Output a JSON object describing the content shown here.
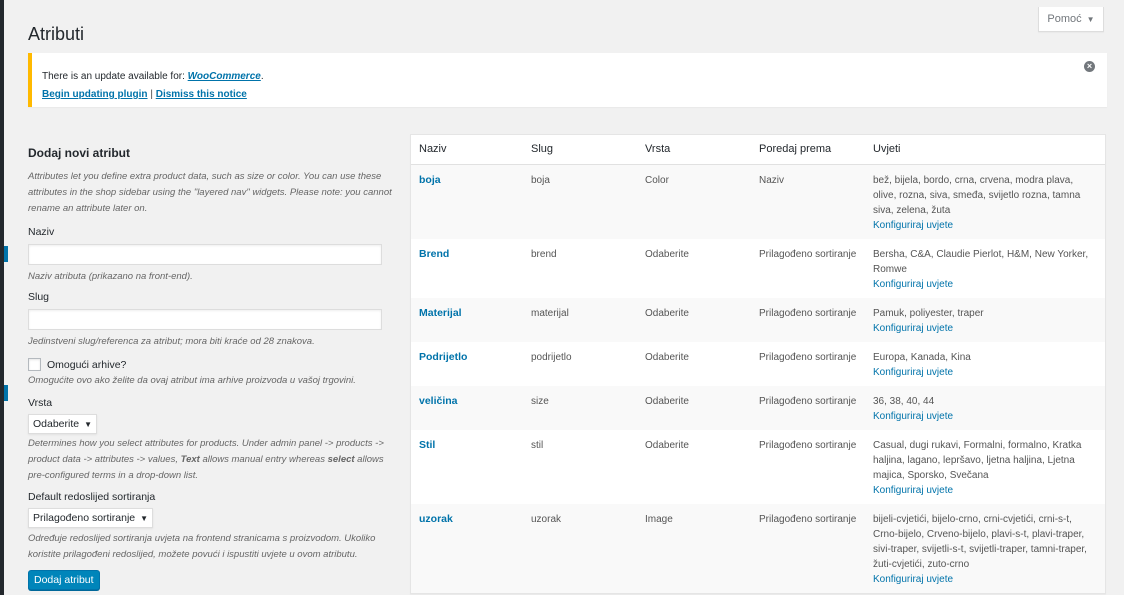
{
  "help": {
    "label": "Pomoć",
    "arrow": "▼"
  },
  "page": {
    "title": "Atributi"
  },
  "notice": {
    "text": "There is an update available for: ",
    "plugin_link": "WooCommerce",
    "text_end": ".",
    "update_link": "Begin updating plugin",
    "separator": "|",
    "dismiss_link": "Dismiss this notice"
  },
  "form": {
    "heading": "Dodaj novi atribut",
    "intro": "Attributes let you define extra product data, such as size or color. You can use these attributes in the shop sidebar using the \"layered nav\" widgets. Please note: you cannot rename an attribute later on.",
    "name_label": "Naziv",
    "name_value": "",
    "name_desc": "Naziv atributa (prikazano na front-end).",
    "slug_label": "Slug",
    "slug_value": "",
    "slug_desc": "Jedinstveni slug/referenca za atribut; mora biti kraće od 28 znakova.",
    "archives_label": "Omogući arhive?",
    "archives_desc": "Omogućite ovo ako želite da ovaj atribut ima arhive proizvoda u vašoj trgovini.",
    "type_label": "Vrsta",
    "type_value": "Odaberite",
    "type_desc_1": "Determines how you select attributes for products. Under admin panel -> products -> product data -> attributes -> values, ",
    "type_desc_bold1": "Text",
    "type_desc_2": " allows manual entry whereas ",
    "type_desc_bold2": "select",
    "type_desc_3": " allows pre-configured terms in a drop-down list.",
    "order_label": "Default redoslijed sortiranja",
    "order_value": "Prilagođeno sortiranje",
    "order_desc": "Određuje redoslijed sortiranja uvjeta na frontend stranicama s proizvodom. Ukoliko koristite prilagođeni redoslijed, možete povući i ispustiti uvjete u ovom atributu.",
    "submit_label": "Dodaj atribut"
  },
  "table": {
    "headers": [
      "Naziv",
      "Slug",
      "Vrsta",
      "Poredaj prema",
      "Uvjeti"
    ],
    "configure_label": "Konfiguriraj uvjete",
    "rows": [
      {
        "name": "boja",
        "slug": "boja",
        "type": "Color",
        "order": "Naziv",
        "terms": "bež, bijela, bordo, crna, crvena, modra plava, olive, rozna, siva, smeđa, svijetlo rozna, tamna siva, zelena, žuta"
      },
      {
        "name": "Brend",
        "slug": "brend",
        "type": "Odaberite",
        "order": "Prilagođeno sortiranje",
        "terms": "Bersha, C&A, Claudie Pierlot, H&M, New Yorker, Romwe"
      },
      {
        "name": "Materijal",
        "slug": "materijal",
        "type": "Odaberite",
        "order": "Prilagođeno sortiranje",
        "terms": "Pamuk, poliyester, traper"
      },
      {
        "name": "Podrijetlo",
        "slug": "podrijetlo",
        "type": "Odaberite",
        "order": "Prilagođeno sortiranje",
        "terms": "Europa, Kanada, Kina"
      },
      {
        "name": "veličina",
        "slug": "size",
        "type": "Odaberite",
        "order": "Prilagođeno sortiranje",
        "terms": "36, 38, 40, 44"
      },
      {
        "name": "Stil",
        "slug": "stil",
        "type": "Odaberite",
        "order": "Prilagođeno sortiranje",
        "terms": "Casual, dugi rukavi, Formalni, formalno, Kratka haljina, lagano, lepršavo, ljetna haljina, Ljetna majica, Sporsko, Svečana"
      },
      {
        "name": "uzorak",
        "slug": "uzorak",
        "type": "Image",
        "order": "Prilagođeno sortiranje",
        "terms": "bijeli-cvjetići, bijelo-crno, crni-cvjetići, crni-s-t, Crno-bijelo, Crveno-bijelo, plavi-s-t, plavi-traper, sivi-traper, svijetli-s-t, svijetli-traper, tamni-traper, žuti-cvjetići, zuto-crno"
      }
    ]
  }
}
